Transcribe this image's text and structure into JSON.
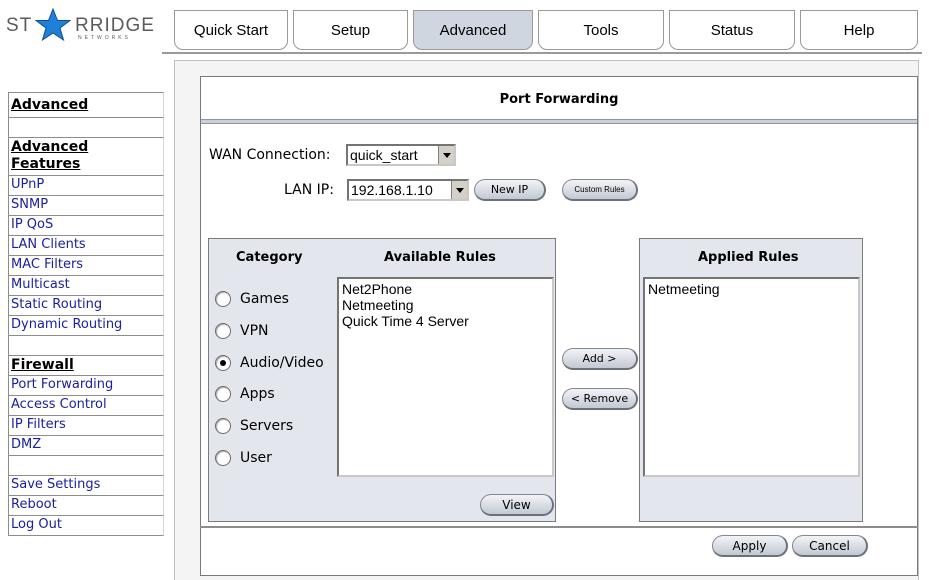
{
  "brand": {
    "name_left": "ST",
    "name_right": "RRIDGE",
    "tagline": "NETWORKS"
  },
  "tabs": [
    {
      "label": "Quick Start",
      "active": false
    },
    {
      "label": "Setup",
      "active": false
    },
    {
      "label": "Advanced",
      "active": true
    },
    {
      "label": "Tools",
      "active": false
    },
    {
      "label": "Status",
      "active": false
    },
    {
      "label": "Help",
      "active": false
    }
  ],
  "sidebar": {
    "section_advanced": "Advanced",
    "advanced_features_line1": "Advanced",
    "advanced_features_line2": "Features",
    "features": [
      "UPnP",
      "SNMP",
      "IP QoS",
      "LAN Clients",
      "MAC Filters",
      "Multicast",
      "Static Routing",
      "Dynamic Routing"
    ],
    "section_firewall": "Firewall",
    "firewall": [
      "Port Forwarding",
      "Access Control",
      "IP Filters",
      "DMZ"
    ],
    "actions": [
      "Save Settings",
      "Reboot",
      "Log Out"
    ]
  },
  "page": {
    "title": "Port Forwarding",
    "wan_label": "WAN Connection:",
    "wan_value": "quick_start",
    "lan_label": "LAN IP:",
    "lan_value": "192.168.1.10",
    "new_ip_button": "New IP",
    "custom_rules_button": "Custom Rules",
    "category_header": "Category",
    "available_header": "Available Rules",
    "applied_header": "Applied Rules",
    "categories": [
      "Games",
      "VPN",
      "Audio/Video",
      "Apps",
      "Servers",
      "User"
    ],
    "selected_category": "Audio/Video",
    "available_rules": [
      "Net2Phone",
      "Netmeeting",
      "Quick Time 4 Server"
    ],
    "applied_rules": [
      "Netmeeting"
    ],
    "add_button": "Add >",
    "remove_button": "< Remove",
    "view_button": "View",
    "apply_button": "Apply",
    "cancel_button": "Cancel"
  },
  "colors": {
    "active_tab": "#cfd6df",
    "link": "#1b20a0",
    "panel_band": "#e3e7ed"
  }
}
